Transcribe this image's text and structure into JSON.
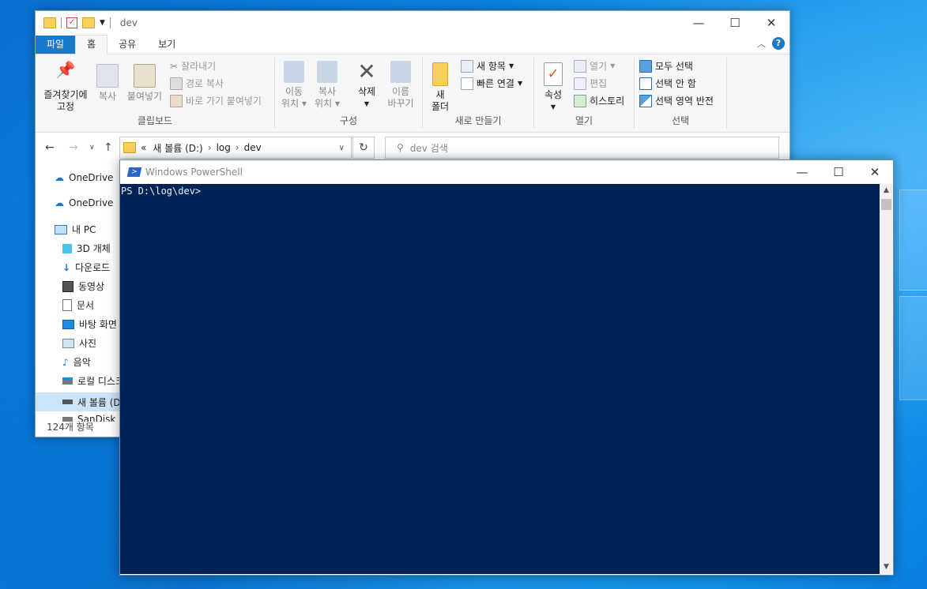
{
  "explorer": {
    "title": "dev",
    "tabs": [
      {
        "label": "파일"
      },
      {
        "label": "홈"
      },
      {
        "label": "공유"
      },
      {
        "label": "보기"
      }
    ],
    "ribbon": {
      "clipboard": {
        "pin_label_1": "즐겨찾기에",
        "pin_label_2": "고정",
        "copy": "복사",
        "paste": "붙여넣기",
        "cut": "잘라내기",
        "copy_path": "경로 복사",
        "paste_shortcut": "바로 가기 붙여넣기",
        "group": "클립보드"
      },
      "organize": {
        "move_1": "이동",
        "move_2": "위치",
        "copy_1": "복사",
        "copy_2": "위치",
        "delete": "삭제",
        "rename_1": "이름",
        "rename_2": "바꾸기",
        "group": "구성"
      },
      "new": {
        "new_folder_1": "새",
        "new_folder_2": "폴더",
        "new_item": "새 항목",
        "easy_access": "빠른 연결",
        "group": "새로 만들기"
      },
      "open": {
        "properties": "속성",
        "open": "열기",
        "edit": "편집",
        "history": "히스토리",
        "group": "열기"
      },
      "select": {
        "select_all": "모두 선택",
        "select_none": "선택 안 함",
        "invert": "선택 영역 반전",
        "group": "선택"
      }
    },
    "address": {
      "prefix": "«",
      "crumbs": [
        "새 볼륨 (D:)",
        "log",
        "dev"
      ]
    },
    "search_placeholder": "dev 검색",
    "nav_items": [
      {
        "label": "OneDrive",
        "icon": "cloud-icon"
      },
      {
        "label": "OneDrive",
        "icon": "cloud-icon"
      },
      {
        "label": "내 PC",
        "icon": "pc-icon"
      },
      {
        "label": "3D 개체",
        "icon": "cube-icon"
      },
      {
        "label": "다운로드",
        "icon": "download-icon"
      },
      {
        "label": "동영상",
        "icon": "film-icon"
      },
      {
        "label": "문서",
        "icon": "document-icon"
      },
      {
        "label": "바탕 화면",
        "icon": "desktop-icon"
      },
      {
        "label": "사진",
        "icon": "picture-icon"
      },
      {
        "label": "음악",
        "icon": "music-icon"
      },
      {
        "label": "로컬 디스크",
        "icon": "disk-icon"
      },
      {
        "label": "새 볼륨 (D",
        "icon": "disk-icon"
      },
      {
        "label": "SanDisk",
        "icon": "usb-icon"
      }
    ],
    "status": "124개 항목"
  },
  "powershell": {
    "title": "Windows PowerShell",
    "prompt": "PS D:\\log\\dev>"
  },
  "colors": {
    "ps_bg": "#012456",
    "accent": "#1979ca"
  }
}
